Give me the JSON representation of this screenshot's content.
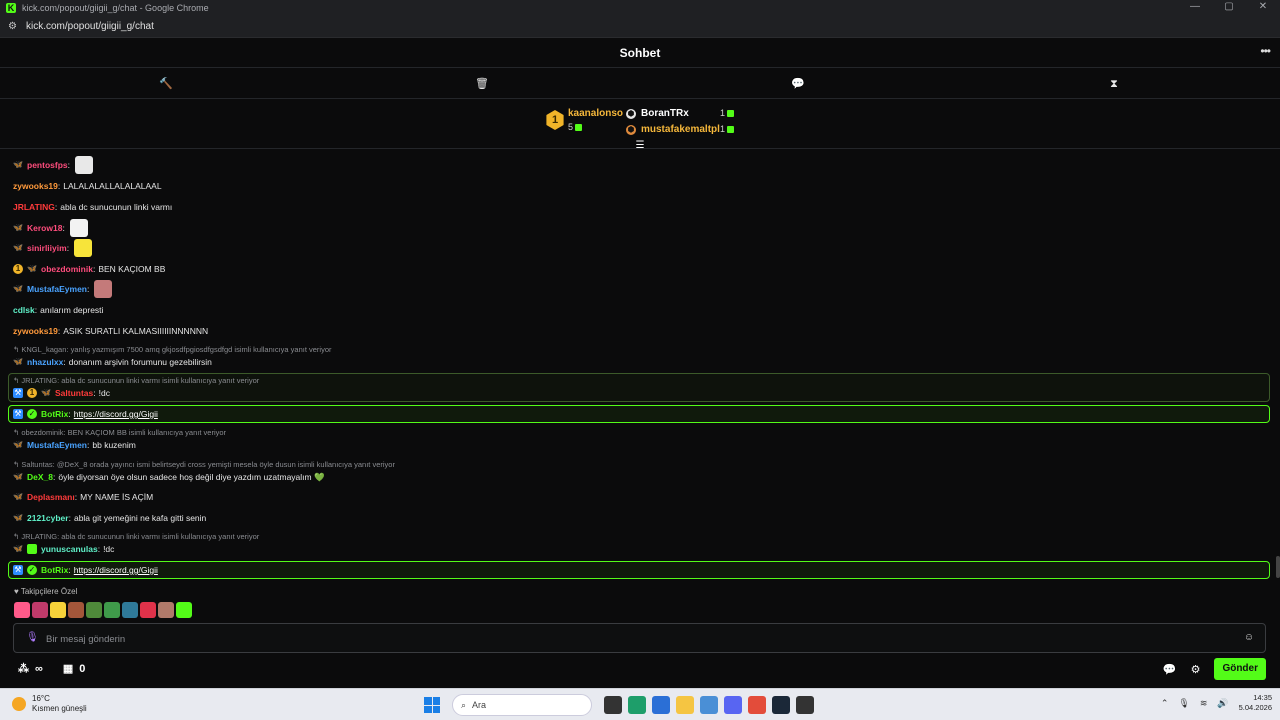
{
  "window": {
    "title": "kick.com/popout/giigii_g/chat - Google Chrome",
    "url": "kick.com/popout/giigii_g/chat",
    "controls": [
      "—",
      "▢",
      "✕"
    ]
  },
  "header": {
    "title": "Sohbet",
    "more_icon": "more-icon"
  },
  "toolbar": {
    "icons": [
      "hammer-icon",
      "trash-icon",
      "chat-bubble-icon",
      "hourglass-icon"
    ]
  },
  "leaderboard": {
    "first": {
      "rank": "1",
      "name": "kaanalonso",
      "count": "5"
    },
    "others": [
      {
        "name": "BoranTRx",
        "count": "1"
      },
      {
        "name": "mustafakemaltpl",
        "count": "1"
      }
    ]
  },
  "messages": [
    {
      "user": "pentosfps",
      "text": ""
    },
    {
      "user": "zywooks19",
      "text": "LALALALALLALALALAAL"
    },
    {
      "user": "JRLATING",
      "text": "abla dc sunucunun linki varmı"
    },
    {
      "user": "Kerow18",
      "text": ""
    },
    {
      "user": "sinirliiyim",
      "text": ""
    },
    {
      "user": "obezdominik",
      "text": "BEN KAÇIOM BB",
      "sub": "1"
    },
    {
      "user": "MustafaEymen",
      "text": ""
    },
    {
      "user": "cdlsk",
      "text": "anılarım depresti"
    },
    {
      "user": "zywooks19",
      "text": "ASIK SURATLI KALMASIIIIIINNNNNN"
    },
    {
      "reply": "KNGL_kagan: yanlış yazmışım 7500 amq gkjosdfpgiosdfgsdfgd isimli kullanıcıya yanıt veriyor",
      "user": "nhazulxx",
      "text": "donanım arşivin forumunu gezebilirsin"
    },
    {
      "reply": "JRLATING: abla dc sunucunun linki varmı isimli kullanıcıya yanıt veriyor",
      "user": "Saltuntas",
      "text": "!dc",
      "sub": "1"
    },
    {
      "user": "BotRix",
      "link": "https://discord.gg/Gigii"
    },
    {
      "reply": "obezdominik: BEN KAÇIOM BB isimli kullanıcıya yanıt veriyor",
      "user": "MustafaEymen",
      "text": "bb kuzenim"
    },
    {
      "reply": "Saltuntas: @DeX_8 orada yayıncı ismi belirtseydi cross yemişti mesela öyle dusun isimli kullanıcıya yanıt veriyor",
      "user": "DeX_8",
      "text": "öyle diyorsan öye olsun sadece hoş değil diye yazdım uzatmayalım 💚"
    },
    {
      "user": "Deplasmanı",
      "text": "MY NAME İS AÇİM"
    },
    {
      "user": "2121cyber",
      "text": "abla git yemeğini ne kafa gitti senin"
    },
    {
      "reply": "JRLATING: abla dc sunucunun linki varmı isimli kullanıcıya yanıt veriyor",
      "user": "yunuscanulas",
      "text": "!dc"
    },
    {
      "user": "BotRix",
      "link": "https://discord.gg/Gigii"
    }
  ],
  "colors": {
    "pink": "#ff4d7d",
    "orange": "#ff9a3c",
    "red": "#ff3b3b",
    "blue": "#4aa3ff",
    "teal": "#5ff0c8",
    "green": "#53fc18",
    "gold": "#f5b73b"
  },
  "emote_strip": {
    "label": "Takipçilere Özel"
  },
  "input": {
    "placeholder": "Bir mesaj gönderin"
  },
  "bottom": {
    "infinity": "∞",
    "store_count": "0",
    "send_label": "Gönder"
  },
  "taskbar": {
    "weather_temp": "16°C",
    "weather_desc": "Kısmen güneşli",
    "search_placeholder": "Ara",
    "time": "14:35",
    "date": "5.04.2026"
  }
}
